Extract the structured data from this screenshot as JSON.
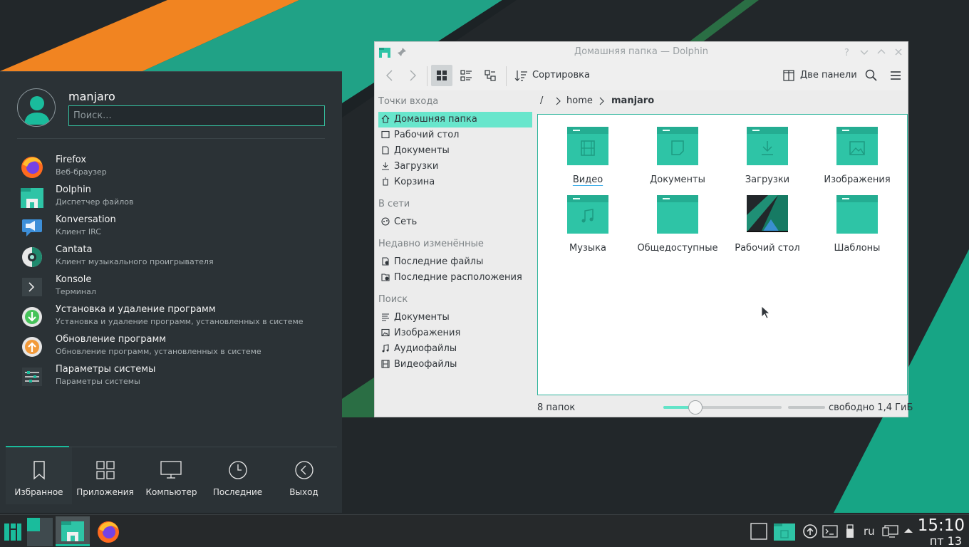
{
  "colors": {
    "accent": "#1abc9c",
    "selection": "#68e6cc",
    "folder": "#2ec4a6",
    "panel": "#2b3236",
    "window": "#ececec"
  },
  "launcher": {
    "user": "manjaro",
    "search_placeholder": "Поиск...",
    "apps": [
      {
        "name": "Firefox",
        "desc": "Веб-браузер",
        "icon": "firefox-icon"
      },
      {
        "name": "Dolphin",
        "desc": "Диспетчер файлов",
        "icon": "folder-icon"
      },
      {
        "name": "Konversation",
        "desc": "Клиент IRC",
        "icon": "chat-icon"
      },
      {
        "name": "Cantata",
        "desc": "Клиент музыкального проигрывателя",
        "icon": "music-player-icon"
      },
      {
        "name": "Konsole",
        "desc": "Терминал",
        "icon": "terminal-icon"
      },
      {
        "name": "Установка и удаление программ",
        "desc": "Установка и удаление программ, установленных в системе",
        "icon": "package-install-icon"
      },
      {
        "name": "Обновление программ",
        "desc": "Обновление программ, установленных в системе",
        "icon": "update-icon"
      },
      {
        "name": "Параметры системы",
        "desc": "Параметры системы",
        "icon": "settings-icon"
      }
    ],
    "tabs": [
      {
        "label": "Избранное",
        "icon": "bookmark-icon"
      },
      {
        "label": "Приложения",
        "icon": "grid-icon"
      },
      {
        "label": "Компьютер",
        "icon": "monitor-icon"
      },
      {
        "label": "Последние",
        "icon": "clock-icon"
      },
      {
        "label": "Выход",
        "icon": "back-circle-icon"
      }
    ]
  },
  "dolphin": {
    "title": "Домашняя папка — Dolphin",
    "toolbar": {
      "sort": "Сортировка",
      "split": "Две панели"
    },
    "places": {
      "sections": [
        {
          "title": "Точки входа",
          "items": [
            "Домашняя папка",
            "Рабочий стол",
            "Документы",
            "Загрузки",
            "Корзина"
          ]
        },
        {
          "title": "В сети",
          "items": [
            "Сеть"
          ]
        },
        {
          "title": "Недавно изменённые",
          "items": [
            "Последние файлы",
            "Последние расположения"
          ]
        },
        {
          "title": "Поиск",
          "items": [
            "Документы",
            "Изображения",
            "Аудиофайлы",
            "Видеофайлы"
          ]
        }
      ]
    },
    "breadcrumb": [
      "/",
      "home",
      "manjaro"
    ],
    "files": [
      {
        "name": "Видео",
        "type": "video"
      },
      {
        "name": "Документы",
        "type": "document"
      },
      {
        "name": "Загрузки",
        "type": "download"
      },
      {
        "name": "Изображения",
        "type": "image"
      },
      {
        "name": "Музыка",
        "type": "music"
      },
      {
        "name": "Общедоступные",
        "type": "plain"
      },
      {
        "name": "Рабочий стол",
        "type": "desktop"
      },
      {
        "name": "Шаблоны",
        "type": "plain"
      }
    ],
    "status": {
      "folders": "8 папок",
      "free": "свободно 1,4 ГиБ",
      "zoom_fraction": 0.27
    }
  },
  "tray": {
    "lang": "ru",
    "time": "15:10",
    "date": "пт 13"
  }
}
